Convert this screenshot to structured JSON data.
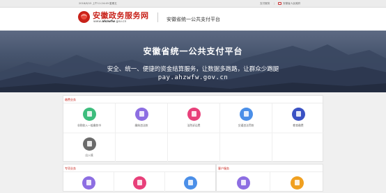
{
  "topbar": {
    "datetime": "2018/6/15 上午11:24:49 星期五",
    "link_pay": "支付服务",
    "link_portal": "安徽省人民政府"
  },
  "header": {
    "logo_title": "安徽政务服务网",
    "logo_url_prefix": "www.",
    "logo_url_brand": "ahzwfw",
    "logo_url_suffix": ".gov.cn",
    "subtitle": "安徽省统一公共支付平台"
  },
  "banner": {
    "title": "安徽省统一公共支付平台",
    "line1": "安全、统一、便捷的资金结算服务，让数据多跑路，让群众少跑腿",
    "url": "pay.ahzwfw.gov.cn"
  },
  "sections": {
    "fees": {
      "title": "缴费业务",
      "items": [
        {
          "label": "非税收入一般缴款书",
          "icon": "receipt-icon",
          "color": "#3dbd7d"
        },
        {
          "label": "缴纳违法款",
          "icon": "wallet-icon",
          "color": "#8d6ee2"
        },
        {
          "label": "法院诉讼费",
          "icon": "gavel-icon",
          "color": "#e8407a"
        },
        {
          "label": "交通违法罚款",
          "icon": "car-icon",
          "color": "#4b8fe8"
        },
        {
          "label": "教育缴费",
          "icon": "graduation-cap-icon",
          "color": "#3a52c4"
        },
        {
          "label": "出入境",
          "icon": "globe-icon",
          "color": "#6b6b6b"
        }
      ]
    },
    "special": {
      "title": "专项业务",
      "items": [
        {
          "label": "",
          "icon": "special-icon-1",
          "color": "#8d6ee2"
        },
        {
          "label": "",
          "icon": "special-icon-2",
          "color": "#e8407a"
        },
        {
          "label": "",
          "icon": "special-icon-3",
          "color": "#4b8fe8"
        }
      ]
    },
    "service": {
      "title": "客户服务",
      "items": [
        {
          "label": "",
          "icon": "help-icon",
          "color": "#8d6ee2"
        },
        {
          "label": "",
          "icon": "headset-icon",
          "color": "#f0a020"
        }
      ]
    }
  },
  "colors": {
    "brand_red": "#c8221a",
    "banner_bg": "#46546d"
  }
}
